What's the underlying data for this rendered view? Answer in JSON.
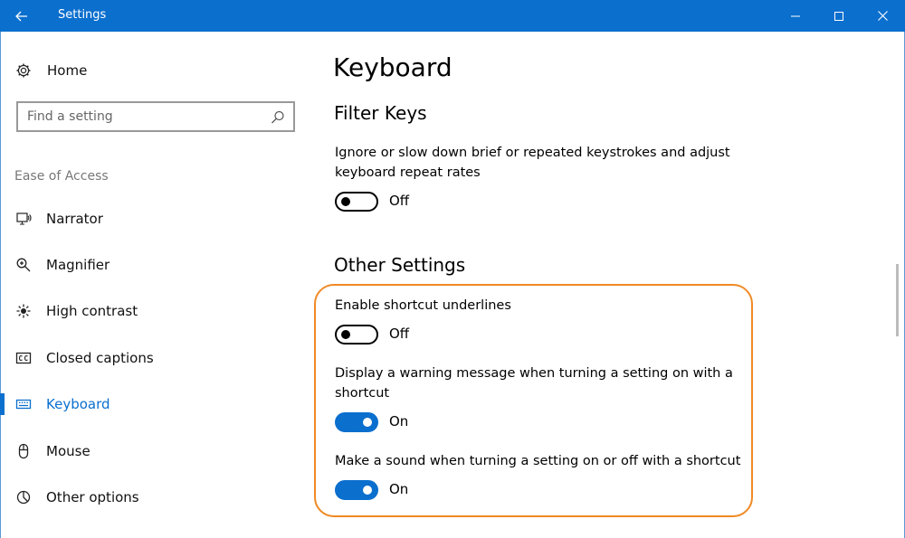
{
  "titlebar": {
    "title": "Settings",
    "back_icon": "back-arrow-icon",
    "minimize_icon": "minimize-icon",
    "maximize_icon": "maximize-icon",
    "close_icon": "close-icon",
    "background_color": "#0b6fce"
  },
  "sidebar": {
    "home_label": "Home",
    "home_icon": "gear-icon",
    "search_placeholder": "Find a setting",
    "search_icon": "search-icon",
    "section_label": "Ease of Access",
    "items": [
      {
        "label": "Narrator",
        "icon": "narrator-icon",
        "active": false
      },
      {
        "label": "Magnifier",
        "icon": "magnifier-icon",
        "active": false
      },
      {
        "label": "High contrast",
        "icon": "high-contrast-icon",
        "active": false
      },
      {
        "label": "Closed captions",
        "icon": "closed-captions-icon",
        "active": false
      },
      {
        "label": "Keyboard",
        "icon": "keyboard-icon",
        "active": true
      },
      {
        "label": "Mouse",
        "icon": "mouse-icon",
        "active": false
      },
      {
        "label": "Other options",
        "icon": "other-options-icon",
        "active": false
      }
    ],
    "accent_color": "#0b6fce"
  },
  "main": {
    "title": "Keyboard",
    "filter_keys": {
      "heading": "Filter Keys",
      "description": "Ignore or slow down brief or repeated keystrokes and adjust keyboard repeat rates",
      "state": "Off"
    },
    "other_settings": {
      "heading": "Other Settings",
      "items": [
        {
          "label": "Enable shortcut underlines",
          "state": "Off",
          "on": false
        },
        {
          "label": "Display a warning message when turning a setting on with a shortcut",
          "state": "On",
          "on": true
        },
        {
          "label": "Make a sound when turning a setting on or off with a shortcut",
          "state": "On",
          "on": true
        }
      ]
    },
    "highlight_color": "#f08a24"
  }
}
